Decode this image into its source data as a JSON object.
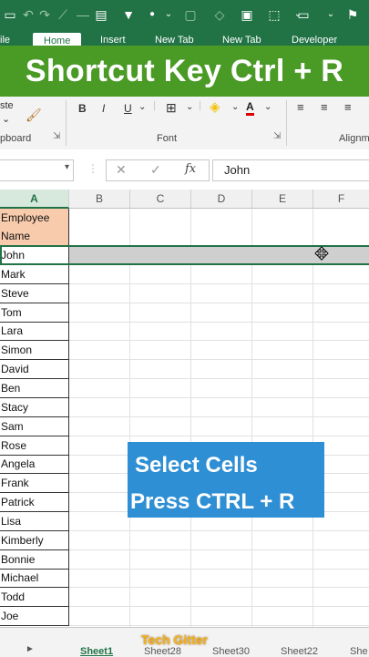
{
  "quick_access": {
    "icons": [
      "save-icon",
      "undo-icon",
      "redo-icon",
      "chart-icon",
      "dash-icon",
      "form-icon",
      "filter-icon",
      "dot-icon",
      "chevron-icon",
      "frame-icon",
      "clear-icon",
      "image-icon",
      "box-icon",
      "flag-icon",
      "comment-icon",
      "more-icon"
    ]
  },
  "ribbon_tabs": [
    "ile",
    "Home",
    "Insert",
    "New Tab",
    "New Tab",
    "Developer"
  ],
  "banner": {
    "title": "Shortcut Key Ctrl + R",
    "color": "#4a9a26"
  },
  "ribbon": {
    "paste_label": "ste",
    "clipboard_label": "pboard",
    "bold": "B",
    "italic": "I",
    "underline": "U",
    "font_color_glyph": "A",
    "font_group_label": "Font",
    "alignment_label": "Alignm"
  },
  "formula_bar": {
    "value": "John",
    "fx": "fx",
    "cancel": "✕",
    "enter": "✓"
  },
  "columns": [
    "A",
    "B",
    "C",
    "D",
    "E",
    "F"
  ],
  "header_cell": {
    "line1": "Employee",
    "line2": "Name",
    "fill": "#f8cbad"
  },
  "employees": [
    "John",
    "Mark",
    "Steve",
    "Tom",
    "Lara",
    "Simon",
    "David",
    "Ben",
    "Stacy",
    "Sam",
    "Rose",
    "Angela",
    "Frank",
    "Patrick",
    "Lisa",
    "Kimberly",
    "Bonnie",
    "Michael",
    "Todd",
    "Joe"
  ],
  "callout": {
    "line1": "Select Cells",
    "line2": "Press CTRL + R",
    "color": "#2f8fd4"
  },
  "sheets": [
    "Sheet1",
    "Sheet28",
    "Sheet30",
    "Sheet22",
    "She"
  ],
  "watermark": "Tech Gitter"
}
